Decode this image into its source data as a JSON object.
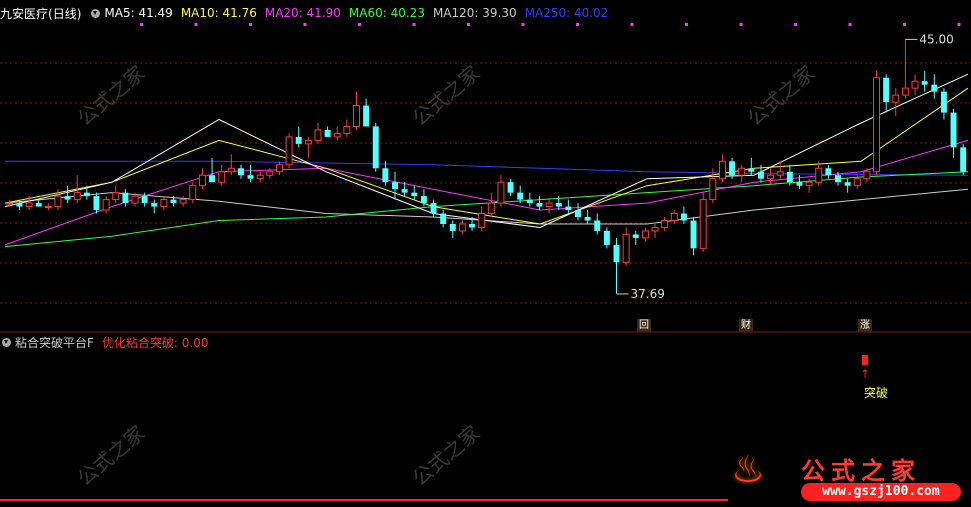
{
  "stock": {
    "name": "九安医疗",
    "period": "(日线)"
  },
  "ma_legend": [
    {
      "label": "MA5: 41.49",
      "color": "#ffffff"
    },
    {
      "label": "MA10: 41.76",
      "color": "#ffff3a"
    },
    {
      "label": "MA20: 41.90",
      "color": "#ff33ff"
    },
    {
      "label": "MA60: 40.23",
      "color": "#33ff33"
    },
    {
      "label": "MA120: 39.30",
      "color": "#cccccc"
    },
    {
      "label": "MA250: 40.02",
      "color": "#3a3aff"
    }
  ],
  "indicator": {
    "name": "粘合突破平台F",
    "value_label": "优化粘合突破: 0.00",
    "name_color": "#cccccc",
    "value_color": "#ff3333"
  },
  "markers": {
    "high_label": "45.00",
    "low_label": "37.69",
    "badges": [
      "回",
      "财",
      "涨"
    ],
    "signal_label": "突破"
  },
  "watermark": {
    "text": "公式之家",
    "url": "www.gszj100.com"
  },
  "brand": {
    "title": "公式之家",
    "url": "www.gszj100.com"
  },
  "colors": {
    "up": "#ff3b3b",
    "down": "#54ffff",
    "grid": "#7a1a1a",
    "background": "#000000"
  },
  "chart_data": {
    "type": "candlestick",
    "y_range": [
      37.0,
      45.5
    ],
    "high": 45.0,
    "low": 37.69,
    "candles": [
      [
        40.3,
        40.4,
        40.2,
        40.3
      ],
      [
        40.3,
        40.4,
        40.1,
        40.2
      ],
      [
        40.2,
        40.5,
        40.1,
        40.3
      ],
      [
        40.3,
        40.4,
        40.2,
        40.2
      ],
      [
        40.2,
        40.3,
        40.1,
        40.2
      ],
      [
        40.2,
        40.7,
        40.1,
        40.5
      ],
      [
        40.5,
        40.8,
        40.3,
        40.4
      ],
      [
        40.4,
        41.1,
        40.3,
        40.6
      ],
      [
        40.6,
        40.8,
        40.4,
        40.5
      ],
      [
        40.5,
        40.6,
        40.0,
        40.1
      ],
      [
        40.1,
        40.5,
        40.0,
        40.4
      ],
      [
        40.4,
        40.8,
        40.3,
        40.6
      ],
      [
        40.6,
        40.7,
        40.2,
        40.3
      ],
      [
        40.3,
        40.6,
        40.2,
        40.5
      ],
      [
        40.5,
        40.6,
        40.2,
        40.3
      ],
      [
        40.3,
        40.4,
        40.0,
        40.2
      ],
      [
        40.2,
        40.5,
        40.1,
        40.4
      ],
      [
        40.4,
        40.5,
        40.2,
        40.3
      ],
      [
        40.3,
        40.5,
        40.2,
        40.4
      ],
      [
        40.4,
        40.9,
        40.3,
        40.8
      ],
      [
        40.8,
        41.3,
        40.7,
        41.1
      ],
      [
        41.1,
        41.6,
        40.9,
        40.9
      ],
      [
        40.9,
        41.4,
        40.8,
        41.2
      ],
      [
        41.2,
        41.7,
        41.1,
        41.3
      ],
      [
        41.3,
        41.4,
        41.0,
        41.1
      ],
      [
        41.1,
        41.4,
        40.9,
        41.0
      ],
      [
        41.0,
        41.2,
        40.9,
        41.1
      ],
      [
        41.1,
        41.3,
        41.0,
        41.2
      ],
      [
        41.2,
        41.5,
        41.1,
        41.4
      ],
      [
        41.4,
        42.3,
        41.3,
        42.2
      ],
      [
        42.2,
        42.5,
        41.9,
        42.0
      ],
      [
        42.0,
        42.2,
        41.6,
        42.1
      ],
      [
        42.1,
        42.6,
        42.0,
        42.4
      ],
      [
        42.4,
        42.5,
        42.2,
        42.2
      ],
      [
        42.2,
        42.5,
        42.1,
        42.3
      ],
      [
        42.3,
        42.7,
        42.2,
        42.5
      ],
      [
        42.5,
        43.5,
        42.4,
        43.1
      ],
      [
        43.1,
        43.3,
        42.9,
        42.5
      ],
      [
        42.5,
        42.6,
        41.2,
        41.3
      ],
      [
        41.3,
        41.5,
        40.8,
        40.9
      ],
      [
        40.9,
        41.2,
        40.4,
        40.7
      ],
      [
        40.7,
        40.9,
        40.5,
        40.6
      ],
      [
        40.6,
        40.8,
        40.4,
        40.5
      ],
      [
        40.5,
        40.7,
        40.2,
        40.3
      ],
      [
        40.3,
        40.4,
        39.9,
        40.0
      ],
      [
        40.0,
        40.1,
        39.6,
        39.7
      ],
      [
        39.7,
        39.8,
        39.3,
        39.5
      ],
      [
        39.5,
        39.8,
        39.4,
        39.7
      ],
      [
        39.7,
        39.9,
        39.5,
        39.6
      ],
      [
        39.6,
        40.2,
        39.5,
        40.0
      ],
      [
        40.0,
        40.6,
        39.9,
        40.3
      ],
      [
        40.3,
        41.1,
        40.2,
        40.9
      ],
      [
        40.9,
        41.0,
        40.5,
        40.6
      ],
      [
        40.6,
        40.8,
        40.3,
        40.4
      ],
      [
        40.4,
        40.6,
        40.2,
        40.3
      ],
      [
        40.3,
        40.5,
        40.1,
        40.2
      ],
      [
        40.2,
        40.4,
        40.0,
        40.3
      ],
      [
        40.3,
        40.5,
        40.1,
        40.2
      ],
      [
        40.2,
        40.4,
        40.0,
        40.1
      ],
      [
        40.1,
        40.3,
        39.8,
        39.9
      ],
      [
        39.9,
        40.1,
        39.7,
        39.8
      ],
      [
        39.8,
        40.0,
        39.4,
        39.5
      ],
      [
        39.5,
        39.6,
        39.0,
        39.1
      ],
      [
        39.1,
        39.3,
        37.7,
        38.6
      ],
      [
        38.6,
        39.6,
        38.5,
        39.4
      ],
      [
        39.4,
        39.5,
        39.1,
        39.3
      ],
      [
        39.3,
        39.6,
        39.2,
        39.5
      ],
      [
        39.5,
        39.7,
        39.3,
        39.6
      ],
      [
        39.6,
        39.9,
        39.5,
        39.8
      ],
      [
        39.8,
        40.1,
        39.7,
        40.0
      ],
      [
        40.0,
        40.2,
        39.7,
        39.8
      ],
      [
        39.8,
        39.9,
        38.8,
        39.0
      ],
      [
        39.0,
        40.6,
        38.9,
        40.4
      ],
      [
        40.4,
        41.3,
        40.3,
        41.0
      ],
      [
        41.0,
        41.7,
        40.9,
        41.5
      ],
      [
        41.5,
        41.6,
        41.0,
        41.1
      ],
      [
        41.1,
        41.4,
        40.9,
        41.3
      ],
      [
        41.3,
        41.6,
        41.1,
        41.2
      ],
      [
        41.2,
        41.4,
        40.9,
        41.0
      ],
      [
        41.0,
        41.3,
        40.8,
        41.1
      ],
      [
        41.1,
        41.5,
        41.0,
        41.2
      ],
      [
        41.2,
        41.4,
        40.8,
        40.9
      ],
      [
        40.9,
        41.1,
        40.7,
        40.8
      ],
      [
        40.8,
        41.0,
        40.6,
        40.9
      ],
      [
        40.9,
        41.5,
        40.8,
        41.3
      ],
      [
        41.3,
        41.4,
        41.0,
        41.1
      ],
      [
        41.1,
        41.2,
        40.8,
        40.9
      ],
      [
        40.9,
        41.0,
        40.6,
        40.8
      ],
      [
        40.8,
        41.1,
        40.7,
        41.0
      ],
      [
        41.0,
        41.3,
        40.9,
        41.2
      ],
      [
        41.2,
        44.1,
        41.1,
        43.9
      ],
      [
        43.9,
        44.0,
        42.9,
        43.2
      ],
      [
        43.2,
        43.6,
        42.8,
        43.4
      ],
      [
        43.4,
        45.0,
        43.3,
        43.6
      ],
      [
        43.6,
        44.0,
        43.4,
        43.8
      ],
      [
        43.8,
        44.1,
        43.5,
        43.7
      ],
      [
        43.7,
        44.0,
        43.3,
        43.5
      ],
      [
        43.5,
        43.6,
        42.7,
        42.9
      ],
      [
        42.9,
        43.0,
        41.6,
        41.9
      ],
      [
        41.9,
        42.0,
        41.1,
        41.2
      ]
    ],
    "ma_series": [
      {
        "name": "MA250",
        "color": "#3a3aff",
        "values": [
          41.5,
          41.5,
          41.5,
          41.45,
          41.4,
          41.3,
          41.2,
          41.15,
          41.12,
          41.1
        ]
      },
      {
        "name": "MA120",
        "color": "#cccccc",
        "values": [
          40.3,
          40.6,
          40.35,
          40.0,
          39.9,
          39.7,
          39.7,
          40.1,
          40.4,
          40.7
        ]
      },
      {
        "name": "MA60",
        "color": "#33ff33",
        "values": [
          39.05,
          39.35,
          39.8,
          39.9,
          40.2,
          40.4,
          40.6,
          40.8,
          41.05,
          41.2
        ]
      },
      {
        "name": "MA20",
        "color": "#ff33ff",
        "values": [
          39.1,
          40.2,
          41.2,
          41.3,
          40.7,
          40.1,
          40.3,
          40.9,
          41.2,
          42.1
        ]
      },
      {
        "name": "MA10",
        "color": "#ffff3a",
        "values": [
          40.3,
          40.9,
          42.1,
          41.3,
          40.2,
          39.7,
          40.8,
          41.3,
          41.5,
          43.6
        ]
      },
      {
        "name": "MA5",
        "color": "#ffffff",
        "values": [
          40.2,
          40.9,
          42.7,
          41.2,
          40.0,
          39.6,
          41.0,
          41.1,
          42.6,
          44.0
        ]
      }
    ]
  }
}
